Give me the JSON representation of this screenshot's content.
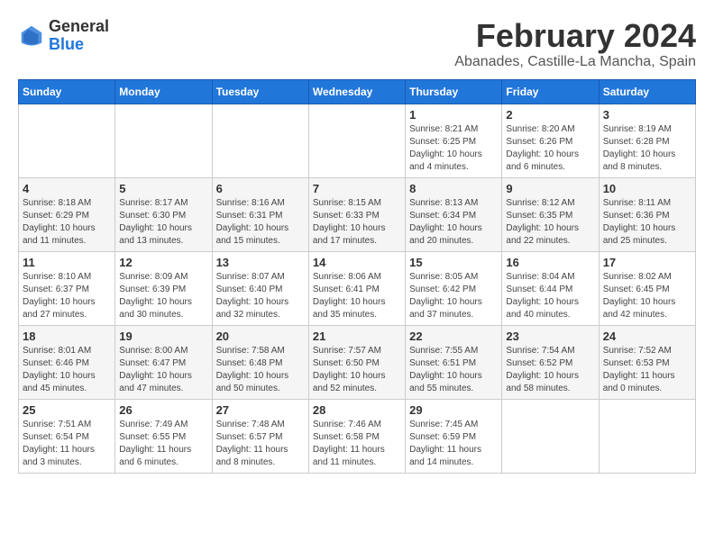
{
  "header": {
    "logo_line1": "General",
    "logo_line2": "Blue",
    "title": "February 2024",
    "subtitle": "Abanades, Castille-La Mancha, Spain"
  },
  "calendar": {
    "columns": [
      "Sunday",
      "Monday",
      "Tuesday",
      "Wednesday",
      "Thursday",
      "Friday",
      "Saturday"
    ],
    "weeks": [
      [
        {
          "day": "",
          "info": ""
        },
        {
          "day": "",
          "info": ""
        },
        {
          "day": "",
          "info": ""
        },
        {
          "day": "",
          "info": ""
        },
        {
          "day": "1",
          "info": "Sunrise: 8:21 AM\nSunset: 6:25 PM\nDaylight: 10 hours\nand 4 minutes."
        },
        {
          "day": "2",
          "info": "Sunrise: 8:20 AM\nSunset: 6:26 PM\nDaylight: 10 hours\nand 6 minutes."
        },
        {
          "day": "3",
          "info": "Sunrise: 8:19 AM\nSunset: 6:28 PM\nDaylight: 10 hours\nand 8 minutes."
        }
      ],
      [
        {
          "day": "4",
          "info": "Sunrise: 8:18 AM\nSunset: 6:29 PM\nDaylight: 10 hours\nand 11 minutes."
        },
        {
          "day": "5",
          "info": "Sunrise: 8:17 AM\nSunset: 6:30 PM\nDaylight: 10 hours\nand 13 minutes."
        },
        {
          "day": "6",
          "info": "Sunrise: 8:16 AM\nSunset: 6:31 PM\nDaylight: 10 hours\nand 15 minutes."
        },
        {
          "day": "7",
          "info": "Sunrise: 8:15 AM\nSunset: 6:33 PM\nDaylight: 10 hours\nand 17 minutes."
        },
        {
          "day": "8",
          "info": "Sunrise: 8:13 AM\nSunset: 6:34 PM\nDaylight: 10 hours\nand 20 minutes."
        },
        {
          "day": "9",
          "info": "Sunrise: 8:12 AM\nSunset: 6:35 PM\nDaylight: 10 hours\nand 22 minutes."
        },
        {
          "day": "10",
          "info": "Sunrise: 8:11 AM\nSunset: 6:36 PM\nDaylight: 10 hours\nand 25 minutes."
        }
      ],
      [
        {
          "day": "11",
          "info": "Sunrise: 8:10 AM\nSunset: 6:37 PM\nDaylight: 10 hours\nand 27 minutes."
        },
        {
          "day": "12",
          "info": "Sunrise: 8:09 AM\nSunset: 6:39 PM\nDaylight: 10 hours\nand 30 minutes."
        },
        {
          "day": "13",
          "info": "Sunrise: 8:07 AM\nSunset: 6:40 PM\nDaylight: 10 hours\nand 32 minutes."
        },
        {
          "day": "14",
          "info": "Sunrise: 8:06 AM\nSunset: 6:41 PM\nDaylight: 10 hours\nand 35 minutes."
        },
        {
          "day": "15",
          "info": "Sunrise: 8:05 AM\nSunset: 6:42 PM\nDaylight: 10 hours\nand 37 minutes."
        },
        {
          "day": "16",
          "info": "Sunrise: 8:04 AM\nSunset: 6:44 PM\nDaylight: 10 hours\nand 40 minutes."
        },
        {
          "day": "17",
          "info": "Sunrise: 8:02 AM\nSunset: 6:45 PM\nDaylight: 10 hours\nand 42 minutes."
        }
      ],
      [
        {
          "day": "18",
          "info": "Sunrise: 8:01 AM\nSunset: 6:46 PM\nDaylight: 10 hours\nand 45 minutes."
        },
        {
          "day": "19",
          "info": "Sunrise: 8:00 AM\nSunset: 6:47 PM\nDaylight: 10 hours\nand 47 minutes."
        },
        {
          "day": "20",
          "info": "Sunrise: 7:58 AM\nSunset: 6:48 PM\nDaylight: 10 hours\nand 50 minutes."
        },
        {
          "day": "21",
          "info": "Sunrise: 7:57 AM\nSunset: 6:50 PM\nDaylight: 10 hours\nand 52 minutes."
        },
        {
          "day": "22",
          "info": "Sunrise: 7:55 AM\nSunset: 6:51 PM\nDaylight: 10 hours\nand 55 minutes."
        },
        {
          "day": "23",
          "info": "Sunrise: 7:54 AM\nSunset: 6:52 PM\nDaylight: 10 hours\nand 58 minutes."
        },
        {
          "day": "24",
          "info": "Sunrise: 7:52 AM\nSunset: 6:53 PM\nDaylight: 11 hours\nand 0 minutes."
        }
      ],
      [
        {
          "day": "25",
          "info": "Sunrise: 7:51 AM\nSunset: 6:54 PM\nDaylight: 11 hours\nand 3 minutes."
        },
        {
          "day": "26",
          "info": "Sunrise: 7:49 AM\nSunset: 6:55 PM\nDaylight: 11 hours\nand 6 minutes."
        },
        {
          "day": "27",
          "info": "Sunrise: 7:48 AM\nSunset: 6:57 PM\nDaylight: 11 hours\nand 8 minutes."
        },
        {
          "day": "28",
          "info": "Sunrise: 7:46 AM\nSunset: 6:58 PM\nDaylight: 11 hours\nand 11 minutes."
        },
        {
          "day": "29",
          "info": "Sunrise: 7:45 AM\nSunset: 6:59 PM\nDaylight: 11 hours\nand 14 minutes."
        },
        {
          "day": "",
          "info": ""
        },
        {
          "day": "",
          "info": ""
        }
      ]
    ]
  }
}
